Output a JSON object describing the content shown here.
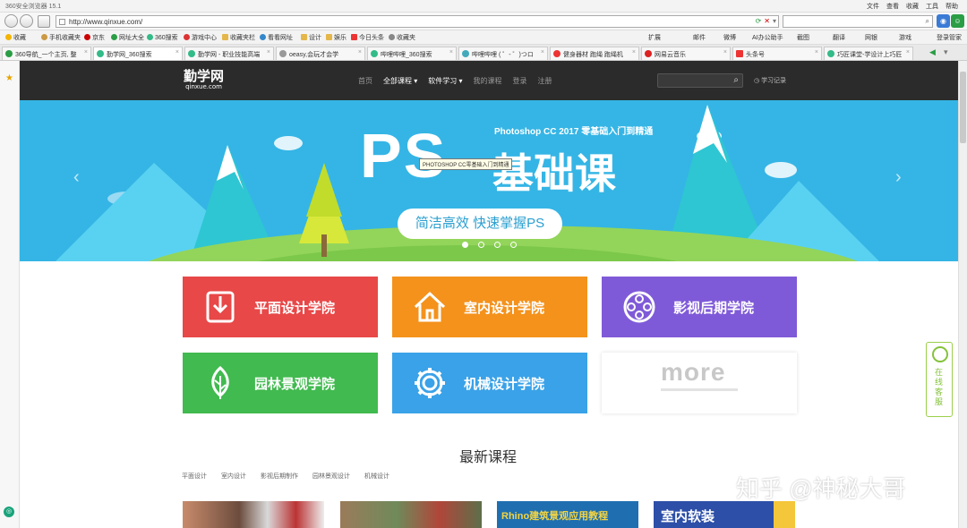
{
  "browser": {
    "title": "360安全浏览器 15.1",
    "menus": [
      "文件",
      "查看",
      "收藏",
      "工具",
      "帮助"
    ],
    "url": "http://www.qinxue.com/",
    "bookmarks": [
      "收藏",
      "手机收藏夹",
      "京东",
      "网址大全",
      "360搜索",
      "游戏中心",
      "收藏夹栏",
      "看看网址",
      "设计",
      "娱乐",
      "今日头条",
      "收藏夹"
    ],
    "right_tools": [
      "扩展",
      "邮件",
      "微博",
      "AI办公助手",
      "截图",
      "翻译",
      "网银",
      "游戏",
      "登录管家"
    ],
    "tabs": [
      "360导航_一个主页, 整",
      "勤学网_360搜索",
      "勤学网 - 职业技能高端",
      "oeasy,会玩才会学",
      "哔哩哔哩_360搜索",
      "哔哩哔哩 ( ゜- ゜)つロ",
      "健身器材 跑绳 跑绳机",
      "网易云音乐",
      "头条号",
      "巧匠课堂-学设计上巧匠"
    ],
    "active_tab": 1
  },
  "site": {
    "logo": "勤学网",
    "logo_domain": "qinxue.com",
    "nav": [
      "首页",
      "全部课程 ▾",
      "软件学习 ▾",
      "我的课程",
      "登录",
      "注册"
    ],
    "history": "学习记录",
    "colors": {
      "header": "#2b2b2b",
      "banner": "#35b5e5"
    }
  },
  "banner": {
    "subtitle": "Photoshop CC 2017 零基础入门到精通",
    "ps": "PS",
    "course": "基础课",
    "pill": "简洁高效  快速掌握PS",
    "tooltip": "PHOTOSHOP CC零基础入门到精通",
    "slide_count": 4,
    "active_slide": 1
  },
  "colleges": [
    {
      "label": "平面设计学院",
      "color": "#e84848",
      "icon": "download-icon"
    },
    {
      "label": "室内设计学院",
      "color": "#f4921c",
      "icon": "house-icon"
    },
    {
      "label": "影视后期学院",
      "color": "#7f5ad8",
      "icon": "film-reel-icon"
    },
    {
      "label": "园林景观学院",
      "color": "#41ba4f",
      "icon": "leaf-icon"
    },
    {
      "label": "机械设计学院",
      "color": "#3aa2e8",
      "icon": "gear-icon"
    }
  ],
  "more_label": "more",
  "latest": {
    "title": "最新课程",
    "categories": [
      "平面设计",
      "室内设计",
      "影视后期制作",
      "园林景观设计",
      "机械设计"
    ],
    "thumbs": [
      "Rhino建筑景观应用教程",
      "室内软装"
    ]
  },
  "online_service": "在线客服",
  "watermark": "知乎 @神秘大哥"
}
